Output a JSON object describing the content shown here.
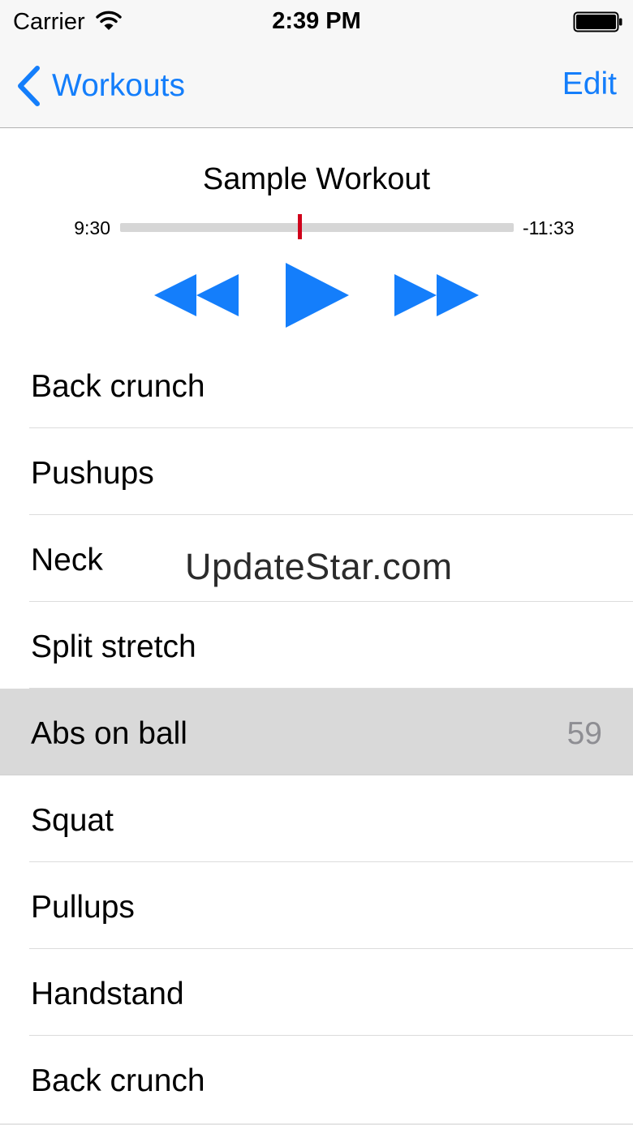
{
  "status_bar": {
    "carrier": "Carrier",
    "time": "2:39 PM",
    "wifi_icon": "wifi-icon",
    "battery_icon": "battery-icon"
  },
  "nav": {
    "back_label": "Workouts",
    "back_icon": "chevron-left-icon",
    "edit_label": "Edit"
  },
  "player": {
    "title": "Sample Workout",
    "elapsed": "9:30",
    "remaining": "-11:33",
    "progress": 0.456,
    "progress_color": "#d0021b",
    "accent_color": "#147efb",
    "controls": [
      "rewind-icon",
      "play-icon",
      "fast-forward-icon"
    ]
  },
  "exercises": [
    {
      "label": "Back crunch",
      "detail": ""
    },
    {
      "label": "Pushups",
      "detail": ""
    },
    {
      "label": "Neck",
      "detail": ""
    },
    {
      "label": "Split stretch",
      "detail": ""
    },
    {
      "label": "Abs on ball",
      "detail": "59",
      "selected": true
    },
    {
      "label": "Squat",
      "detail": ""
    },
    {
      "label": "Pullups",
      "detail": ""
    },
    {
      "label": "Handstand",
      "detail": ""
    },
    {
      "label": "Back crunch",
      "detail": ""
    }
  ],
  "watermark": "UpdateStar.com"
}
